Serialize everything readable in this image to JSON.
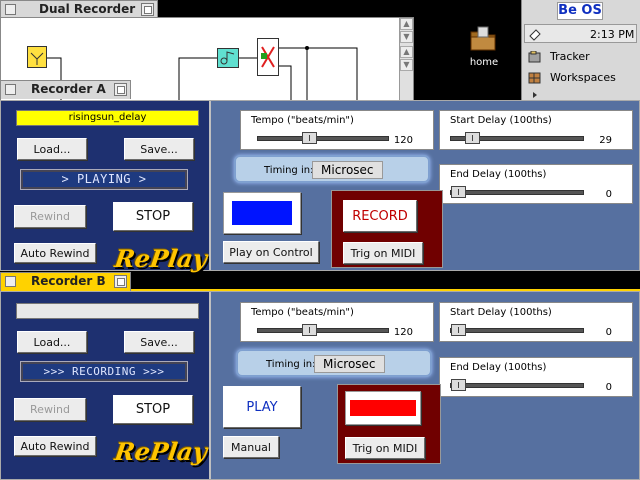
{
  "dual_window": {
    "title": "Dual Recorder"
  },
  "desktop": {
    "home_label": "home"
  },
  "deskbar": {
    "logo": "Be OS",
    "clock": "2:13 PM",
    "items": [
      {
        "label": "Tracker"
      },
      {
        "label": "Workspaces"
      }
    ]
  },
  "recorder_a": {
    "title": "Recorder A",
    "name": "risingsun_delay",
    "load_label": "Load...",
    "save_label": "Save...",
    "status": "> PLAYING >",
    "rewind_label": "Rewind",
    "stop_label": "STOP",
    "auto_rewind_label": "Auto Rewind",
    "logo": "RePlay",
    "tempo": {
      "label": "Tempo (\"beats/min\")",
      "value": "120",
      "level": 0.38
    },
    "start_delay": {
      "label": "Start Delay (100ths)",
      "value": "29",
      "level": 0.12
    },
    "end_delay": {
      "label": "End Delay (100ths)",
      "value": "0",
      "level": 0
    },
    "timing": {
      "label": "Timing in:",
      "value": "Microsec"
    },
    "control_color": "#0014ff",
    "control_label": "Play on Control",
    "record_label": "RECORD",
    "trig_label": "Trig on MIDI"
  },
  "recorder_b": {
    "title": "Recorder B",
    "name": "",
    "load_label": "Load...",
    "save_label": "Save...",
    "status": ">>> RECORDING >>>",
    "rewind_label": "Rewind",
    "stop_label": "STOP",
    "auto_rewind_label": "Auto Rewind",
    "logo": "RePlay",
    "tempo": {
      "label": "Tempo (\"beats/min\")",
      "value": "120",
      "level": 0.38
    },
    "start_delay": {
      "label": "Start Delay (100ths)",
      "value": "0",
      "level": 0
    },
    "end_delay": {
      "label": "End Delay (100ths)",
      "value": "0",
      "level": 0
    },
    "timing": {
      "label": "Timing in:",
      "value": "Microsec"
    },
    "play_label": "PLAY",
    "manual_label": "Manual",
    "trig_color": "#ff0000",
    "trig_label": "Trig on MIDI"
  }
}
